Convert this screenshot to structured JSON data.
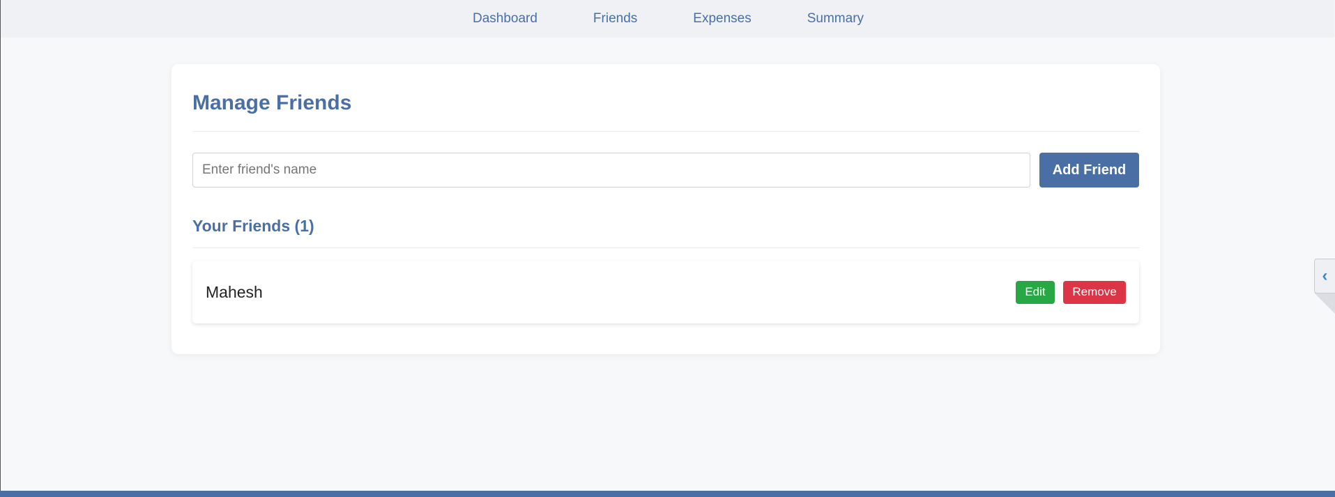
{
  "nav": {
    "items": [
      {
        "label": "Dashboard"
      },
      {
        "label": "Friends"
      },
      {
        "label": "Expenses"
      },
      {
        "label": "Summary"
      }
    ]
  },
  "card": {
    "title": "Manage Friends",
    "input_placeholder": "Enter friend's name",
    "input_value": "",
    "add_button_label": "Add Friend",
    "list_heading": "Your Friends (1)"
  },
  "friends": [
    {
      "name": "Mahesh",
      "edit_label": "Edit",
      "remove_label": "Remove"
    }
  ],
  "side_tab": {
    "icon": "chevron-left-icon"
  },
  "colors": {
    "accent": "#4a6fa5",
    "edit": "#28a745",
    "remove": "#dc3545"
  }
}
